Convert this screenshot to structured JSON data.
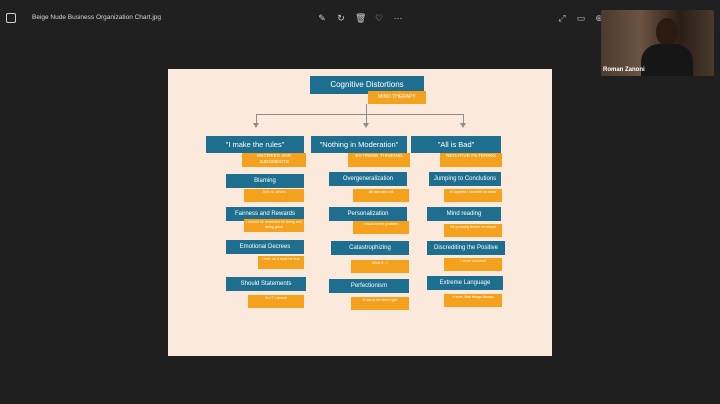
{
  "window": {
    "file_title": "Beige Nude Business Organization Chart.jpg"
  },
  "toolbar": {
    "icons": [
      "edit-icon",
      "rotate-icon",
      "delete-icon",
      "favorite-icon",
      "more-icon"
    ],
    "glyphs": {
      "edit": "✎",
      "rotate": "↻",
      "delete": "🗑",
      "favorite": "♡",
      "more": "···",
      "expand": "⤢",
      "window": "▭",
      "zoom": "⊕"
    }
  },
  "video": {
    "name": "Roman Zanoni"
  },
  "chart": {
    "title": "Cognitive Distortions",
    "subtitle": "MIND THERAPY",
    "categories": [
      {
        "title": "\"I make the rules\"",
        "subtitle": "DECREES AND JUDGMENTS",
        "items": [
          {
            "title": "Blaming",
            "sub": "Self vs. others"
          },
          {
            "title": "Fairness and Rewards",
            "sub": "I should be rewarded for being and doing good"
          },
          {
            "title": "Emotional Decrees",
            "sub": "I feel, so it must be true"
          },
          {
            "title": "Should Statements",
            "sub": "It's IT I should"
          }
        ]
      },
      {
        "title": "\"Nothing in Moderation\"",
        "subtitle": "EXTREME THINKING",
        "items": [
          {
            "title": "Overgeneralization",
            "sub": "All men are evil"
          },
          {
            "title": "Personalization",
            "sub": "I must be the problem"
          },
          {
            "title": "Catastrophizing",
            "sub": "What if...?"
          },
          {
            "title": "Perfectionism",
            "sub": "It has to be done right"
          }
        ]
      },
      {
        "title": "\"All is Bad\"",
        "subtitle": "NEGATIVE FILTERING",
        "items": [
          {
            "title": "Jumping to Conclutions",
            "sub": "If I applied I wouldn't be hired"
          },
          {
            "title": "Mind reading",
            "sub": "He probably thinks I'm stupid"
          },
          {
            "title": "Discrediting the Positive",
            "sub": "I never succeed"
          },
          {
            "title": "Extreme Language",
            "sub": "Y-ever, Bad things Always"
          }
        ]
      }
    ]
  },
  "colors": {
    "teal": "#1e6f8f",
    "orange": "#f4a21d",
    "paper": "#fbe9dc",
    "background": "#1f1f1f"
  }
}
